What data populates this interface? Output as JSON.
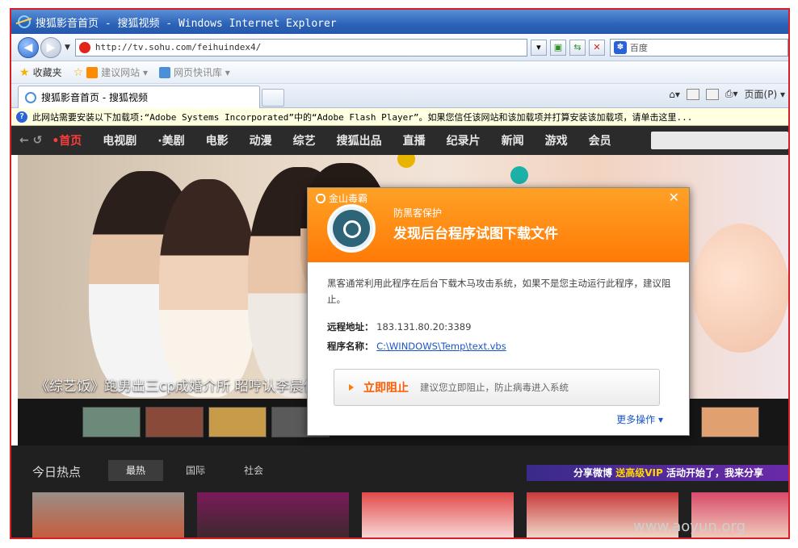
{
  "window": {
    "title": "搜狐影音首页 - 搜狐视频 - Windows Internet Explorer"
  },
  "navbar": {
    "url": "http://tv.sohu.com/feihuindex4/",
    "search_placeholder": "百度"
  },
  "favorites": {
    "label": "收藏夹",
    "items": [
      "建议网站 ▾",
      "网页快讯库 ▾"
    ]
  },
  "tabs": [
    {
      "label": "搜狐影音首页 - 搜狐视频"
    }
  ],
  "commandbar": {
    "page_label": "页面(P) ▾"
  },
  "infobar": {
    "text": "此网站需要安装以下加载项:“Adobe Systems Incorporated”中的“Adobe Flash Player”。如果您信任该网站和该加载项并打算安装该加载项，请单击这里..."
  },
  "site_nav": {
    "items": [
      "•首页",
      "电视剧",
      "·美剧",
      "电影",
      "动漫",
      "综艺",
      "搜狐出品",
      "直播",
      "纪录片",
      "新闻",
      "游戏",
      "会员"
    ]
  },
  "banner": {
    "caption": "《综艺饭》跑男出三cp成婚介所 昭哼认李晨作父"
  },
  "hot": {
    "title": "今日热点",
    "tabs": [
      "最热",
      "国际",
      "社会"
    ],
    "promo_prefix": "分享微博",
    "promo_vip": "送高级VIP",
    "promo_suffix": "活动开始了，我来分享",
    "watermark": "www.aoyun.org"
  },
  "popup": {
    "brand": "金山毒霸",
    "subtitle": "防黑客保护",
    "title": "发现后台程序试图下载文件",
    "description": "黑客通常利用此程序在后台下载木马攻击系统，如果不是您主动运行此程序，建议阻止。",
    "remote_label": "远程地址：",
    "remote_value": "183.131.80.20:3389",
    "program_label": "程序名称：",
    "program_value": "C:\\WINDOWS\\Temp\\text.vbs",
    "block_label": "立即阻止",
    "block_hint": "建议您立即阻止，防止病毒进入系统",
    "more_label": "更多操作 ▾"
  },
  "colors": {
    "popup_orange": "#ff7a06",
    "nav_active": "#ff3c3c",
    "border_red": "#d81f26"
  }
}
